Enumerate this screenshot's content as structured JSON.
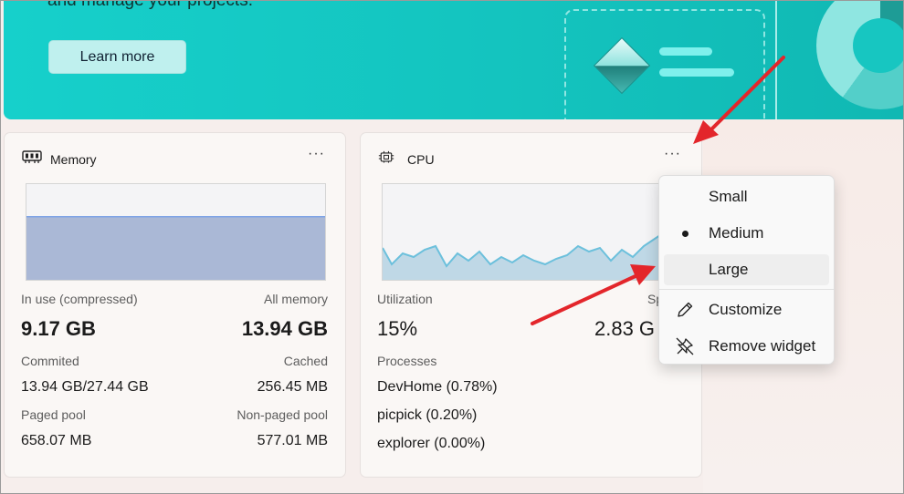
{
  "banner": {
    "text": "and manage your projects.",
    "learn_more_label": "Learn more"
  },
  "memory_widget": {
    "title": "Memory",
    "more_label": "···",
    "in_use_label": "In use (compressed)",
    "in_use_value": "9.17 GB",
    "all_memory_label": "All memory",
    "all_memory_value": "13.94 GB",
    "committed_label": "Commited",
    "committed_value": "13.94 GB/27.44 GB",
    "cached_label": "Cached",
    "cached_value": "256.45 MB",
    "paged_pool_label": "Paged pool",
    "paged_pool_value": "658.07 MB",
    "non_paged_pool_label": "Non-paged pool",
    "non_paged_pool_value": "577.01 MB",
    "usage_level": 0.66
  },
  "cpu_widget": {
    "title": "CPU",
    "more_label": "···",
    "utilization_label": "Utilization",
    "utilization_value": "15%",
    "speed_label_partial": "Sp",
    "speed_value_partial": "2.83 G",
    "processes_label": "Processes",
    "processes": [
      "DevHome (0.78%)",
      "picpick (0.20%)",
      "explorer (0.00%)"
    ]
  },
  "context_menu": {
    "items": [
      {
        "label": "Small",
        "selected": false
      },
      {
        "label": "Medium",
        "selected": true
      },
      {
        "label": "Large",
        "selected": false
      },
      {
        "label": "Customize",
        "icon": "pencil-icon"
      },
      {
        "label": "Remove widget",
        "icon": "unpin-icon"
      }
    ]
  },
  "colors": {
    "banner": "#16d0cb",
    "memory_fill": "#aab8d6",
    "cpu_line": "#6cc0dc",
    "arrow": "#e3262b"
  }
}
